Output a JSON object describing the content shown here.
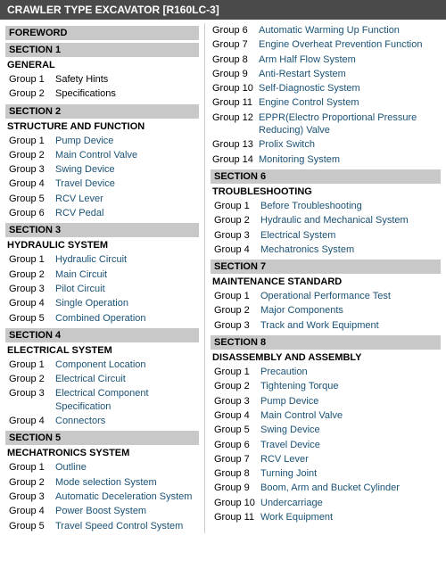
{
  "title": "CRAWLER TYPE EXCAVATOR [R160LC-3]",
  "left": {
    "foreword": "FOREWORD",
    "sections": [
      {
        "header": "SECTION 1",
        "subsection": "GENERAL",
        "groups": [
          {
            "label": "Group 1",
            "text": "Safety Hints",
            "color": "black"
          },
          {
            "label": "Group 2",
            "text": "Specifications",
            "color": "black"
          }
        ]
      },
      {
        "header": "SECTION 2",
        "subsection": "STRUCTURE AND FUNCTION",
        "groups": [
          {
            "label": "Group 1",
            "text": "Pump Device",
            "color": "blue"
          },
          {
            "label": "Group 2",
            "text": "Main Control Valve",
            "color": "blue"
          },
          {
            "label": "Group 3",
            "text": "Swing Device",
            "color": "blue"
          },
          {
            "label": "Group 4",
            "text": "Travel Device",
            "color": "blue"
          },
          {
            "label": "Group 5",
            "text": "RCV Lever",
            "color": "blue"
          },
          {
            "label": "Group 6",
            "text": "RCV Pedal",
            "color": "blue"
          }
        ]
      },
      {
        "header": "SECTION 3",
        "subsection": "HYDRAULIC SYSTEM",
        "groups": [
          {
            "label": "Group 1",
            "text": "Hydraulic Circuit",
            "color": "blue"
          },
          {
            "label": "Group 2",
            "text": "Main Circuit",
            "color": "blue"
          },
          {
            "label": "Group 3",
            "text": "Pilot Circuit",
            "color": "blue"
          },
          {
            "label": "Group 4",
            "text": "Single Operation",
            "color": "blue"
          },
          {
            "label": "Group 5",
            "text": "Combined Operation",
            "color": "blue"
          }
        ]
      },
      {
        "header": "SECTION 4",
        "subsection": "ELECTRICAL SYSTEM",
        "groups": [
          {
            "label": "Group 1",
            "text": "Component Location",
            "color": "blue"
          },
          {
            "label": "Group 2",
            "text": "Electrical Circuit",
            "color": "blue"
          },
          {
            "label": "Group 3",
            "text": "Electrical Component Specification",
            "color": "blue"
          },
          {
            "label": "Group 4",
            "text": "Connectors",
            "color": "blue"
          }
        ]
      },
      {
        "header": "SECTION 5",
        "subsection": "MECHATRONICS SYSTEM",
        "groups": [
          {
            "label": "Group 1",
            "text": "Outline",
            "color": "blue"
          },
          {
            "label": "Group 2",
            "text": "Mode selection System",
            "color": "blue"
          },
          {
            "label": "Group 3",
            "text": "Automatic Deceleration System",
            "color": "blue"
          },
          {
            "label": "Group 4",
            "text": "Power Boost System",
            "color": "blue"
          },
          {
            "label": "Group 5",
            "text": "Travel Speed Control System",
            "color": "blue"
          }
        ]
      }
    ]
  },
  "right": {
    "sections": [
      {
        "header": null,
        "subsection": null,
        "groups": [
          {
            "label": "Group 6",
            "text": "Automatic Warming Up Function",
            "color": "blue"
          },
          {
            "label": "Group 7",
            "text": "Engine Overheat Prevention Function",
            "color": "blue"
          },
          {
            "label": "Group 8",
            "text": "Arm Half Flow System",
            "color": "blue"
          },
          {
            "label": "Group 9",
            "text": "Anti-Restart System",
            "color": "blue"
          },
          {
            "label": "Group 10",
            "text": "Self-Diagnostic System",
            "color": "blue"
          },
          {
            "label": "Group 11",
            "text": "Engine Control System",
            "color": "blue"
          },
          {
            "label": "Group 12",
            "text": "EPPR(Electro Proportional Pressure Reducing) Valve",
            "color": "blue"
          },
          {
            "label": "Group 13",
            "text": "Prolix Switch",
            "color": "blue"
          },
          {
            "label": "Group 14",
            "text": "Monitoring System",
            "color": "blue"
          }
        ]
      },
      {
        "header": "SECTION 6",
        "subsection": "TROUBLESHOOTING",
        "groups": [
          {
            "label": "Group 1",
            "text": "Before Troubleshooting",
            "color": "blue"
          },
          {
            "label": "Group 2",
            "text": "Hydraulic and Mechanical System",
            "color": "blue"
          },
          {
            "label": "Group 3",
            "text": "Electrical System",
            "color": "blue"
          },
          {
            "label": "Group 4",
            "text": "Mechatronics System",
            "color": "blue"
          }
        ]
      },
      {
        "header": "SECTION 7",
        "subsection": "MAINTENANCE STANDARD",
        "groups": [
          {
            "label": "Group 1",
            "text": "Operational Performance Test",
            "color": "blue"
          },
          {
            "label": "Group 2",
            "text": "Major Components",
            "color": "blue"
          },
          {
            "label": "Group 3",
            "text": "Track and Work Equipment",
            "color": "blue"
          }
        ]
      },
      {
        "header": "SECTION 8",
        "subsection": "DISASSEMBLY AND ASSEMBLY",
        "groups": [
          {
            "label": "Group 1",
            "text": "Precaution",
            "color": "blue"
          },
          {
            "label": "Group 2",
            "text": "Tightening Torque",
            "color": "blue"
          },
          {
            "label": "Group 3",
            "text": "Pump Device",
            "color": "blue"
          },
          {
            "label": "Group 4",
            "text": "Main Control Valve",
            "color": "blue"
          },
          {
            "label": "Group 5",
            "text": "Swing Device",
            "color": "blue"
          },
          {
            "label": "Group 6",
            "text": "Travel Device",
            "color": "blue"
          },
          {
            "label": "Group 7",
            "text": "RCV Lever",
            "color": "blue"
          },
          {
            "label": "Group 8",
            "text": "Turning Joint",
            "color": "blue"
          },
          {
            "label": "Group 9",
            "text": "Boom, Arm and Bucket Cylinder",
            "color": "blue"
          },
          {
            "label": "Group 10",
            "text": "Undercarriage",
            "color": "blue"
          },
          {
            "label": "Group 11",
            "text": "Work Equipment",
            "color": "blue"
          }
        ]
      }
    ]
  }
}
